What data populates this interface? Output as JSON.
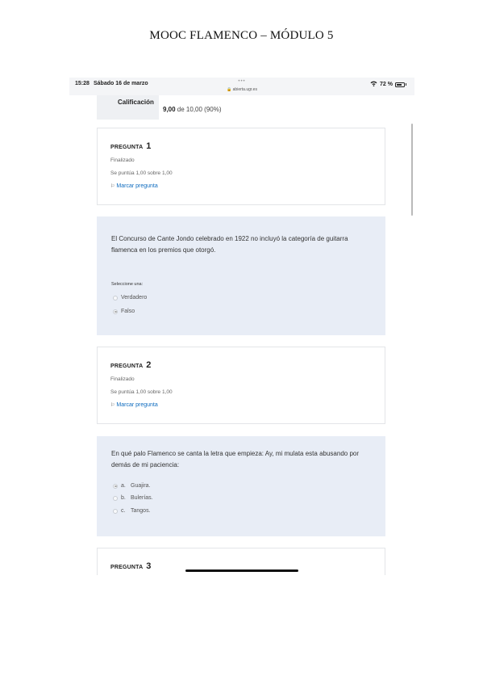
{
  "document": {
    "title": "MOOC FLAMENCO – MÓDULO 5"
  },
  "status_bar": {
    "time": "15:28",
    "date": "Sábado 16 de marzo",
    "dots": "•••",
    "url": "🔒 abierta.ugr.es",
    "battery_text": "72 %",
    "battery_level": 0.72,
    "wifi_icon": "wifi-icon",
    "battery_icon": "battery-icon"
  },
  "grade": {
    "label": "Calificación",
    "value_bold": "9,00",
    "value_rest": " de 10,00 (90%)"
  },
  "questions": [
    {
      "heading": "PREGUNTA",
      "number": "1",
      "state": "Finalizado",
      "score": "Se puntúa 1,00 sobre 1,00",
      "flag_label": "Marcar pregunta",
      "text": "El Concurso de Cante Jondo celebrado en 1922 no incluyó la categoría de guitarra flamenca en los premios que otorgó.",
      "select_label": "Seleccione una:",
      "options": [
        {
          "letter": "",
          "label": "Verdadero",
          "checked": false
        },
        {
          "letter": "",
          "label": "Falso",
          "checked": true
        }
      ]
    },
    {
      "heading": "PREGUNTA",
      "number": "2",
      "state": "Finalizado",
      "score": "Se puntúa 1,00 sobre 1,00",
      "flag_label": "Marcar pregunta",
      "text": "En qué palo Flamenco se canta la letra que empieza: Ay, mi mulata esta abusando por demás de mi paciencia:",
      "options": [
        {
          "letter": "a.",
          "label": "Guajira.",
          "checked": true
        },
        {
          "letter": "b.",
          "label": "Bulerías.",
          "checked": false
        },
        {
          "letter": "c.",
          "label": "Tangos.",
          "checked": false
        }
      ]
    },
    {
      "heading": "PREGUNTA",
      "number": "3"
    }
  ]
}
